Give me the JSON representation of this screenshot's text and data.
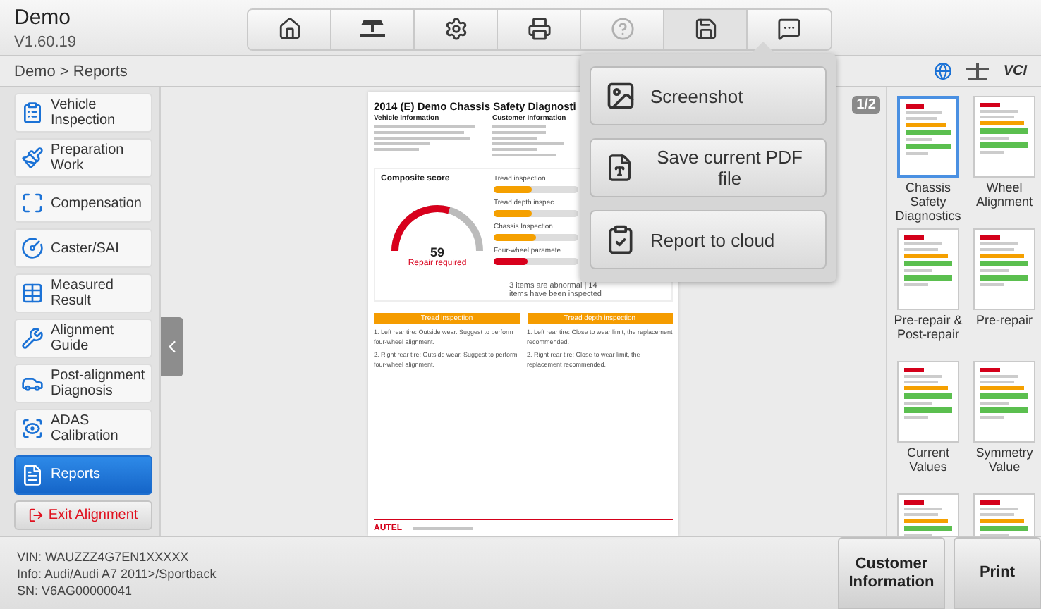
{
  "app": {
    "title": "Demo",
    "version": "V1.60.19"
  },
  "toolbar": [
    {
      "kind": "home",
      "selected": false,
      "disabled": false
    },
    {
      "kind": "lift",
      "selected": false,
      "disabled": false
    },
    {
      "kind": "settings",
      "selected": false,
      "disabled": false
    },
    {
      "kind": "print",
      "selected": false,
      "disabled": false
    },
    {
      "kind": "help",
      "selected": false,
      "disabled": true
    },
    {
      "kind": "save",
      "selected": true,
      "disabled": false
    },
    {
      "kind": "message",
      "selected": false,
      "disabled": false
    }
  ],
  "breadcrumb": "Demo > Reports",
  "status": {
    "vci": "VCI"
  },
  "sidebar": {
    "items": [
      {
        "kind": "inspection",
        "label": "Vehicle Inspection",
        "selected": false
      },
      {
        "kind": "preparation",
        "label": "Preparation Work",
        "selected": false
      },
      {
        "kind": "compensation",
        "label": "Compensation",
        "selected": false
      },
      {
        "kind": "caster",
        "label": "Caster/SAI",
        "selected": false
      },
      {
        "kind": "measured",
        "label": "Measured Result",
        "selected": false
      },
      {
        "kind": "guide",
        "label": "Alignment Guide",
        "selected": false
      },
      {
        "kind": "post",
        "label": "Post-alignment Diagnosis",
        "selected": false
      },
      {
        "kind": "adas",
        "label": "ADAS Calibration",
        "selected": false
      },
      {
        "kind": "reports",
        "label": "Reports",
        "selected": true
      }
    ],
    "exit": "Exit Alignment"
  },
  "report": {
    "title": "2014 (E) Demo Chassis Safety Diagnosti",
    "vehicle_heading": "Vehicle Information",
    "customer_heading": "Customer Information",
    "score_heading": "Composite score",
    "score": "59",
    "verdict": "Repair required",
    "checks": [
      {
        "label": "Tread inspection",
        "level": 0.45,
        "color": "#f5a000"
      },
      {
        "label": "Tread depth inspec",
        "level": 0.45,
        "color": "#f5a000"
      },
      {
        "label": "Chassis Inspection",
        "level": 0.5,
        "color": "#f5a000"
      },
      {
        "label": "Four-wheel paramete",
        "level": 0.4,
        "color": "#d8001c"
      }
    ],
    "summary": "3 items are abnormal | 14 items have been inspected",
    "panels": [
      {
        "heading": "Tread inspection",
        "lines": [
          "1. Left rear tire: Outside wear. Suggest to perform four-wheel alignment.",
          "2. Right rear tire: Outside wear. Suggest to perform four-wheel alignment."
        ]
      },
      {
        "heading": "Tread depth inspection",
        "lines": [
          "1. Left rear tire: Close to wear limit, the replacement recommended.",
          "2. Right rear tire: Close to wear limit, the replacement recommended."
        ]
      }
    ],
    "brand": "AUTEL"
  },
  "page_indicator": "1/2",
  "thumbnails": [
    {
      "label": "Chassis Safety Diagnostics",
      "selected": true
    },
    {
      "label": "Wheel Alignment",
      "selected": false
    },
    {
      "label": "Pre-repair & Post-repair",
      "selected": false
    },
    {
      "label": "Pre-repair",
      "selected": false
    },
    {
      "label": "Current Values",
      "selected": false
    },
    {
      "label": "Symmetry Value",
      "selected": false
    },
    {
      "selected": false
    },
    {
      "selected": false
    }
  ],
  "save_menu": [
    {
      "kind": "image",
      "label": "Screenshot"
    },
    {
      "kind": "pdf",
      "label": "Save current PDF file"
    },
    {
      "kind": "cloud",
      "label": "Report to cloud"
    }
  ],
  "footer": {
    "lines": [
      "VIN: WAUZZZ4G7EN1XXXXX",
      "Info: Audi/Audi A7 2011>/Sportback",
      "SN: V6AG00000041"
    ],
    "buttons": [
      "Customer Information",
      "Print"
    ]
  }
}
